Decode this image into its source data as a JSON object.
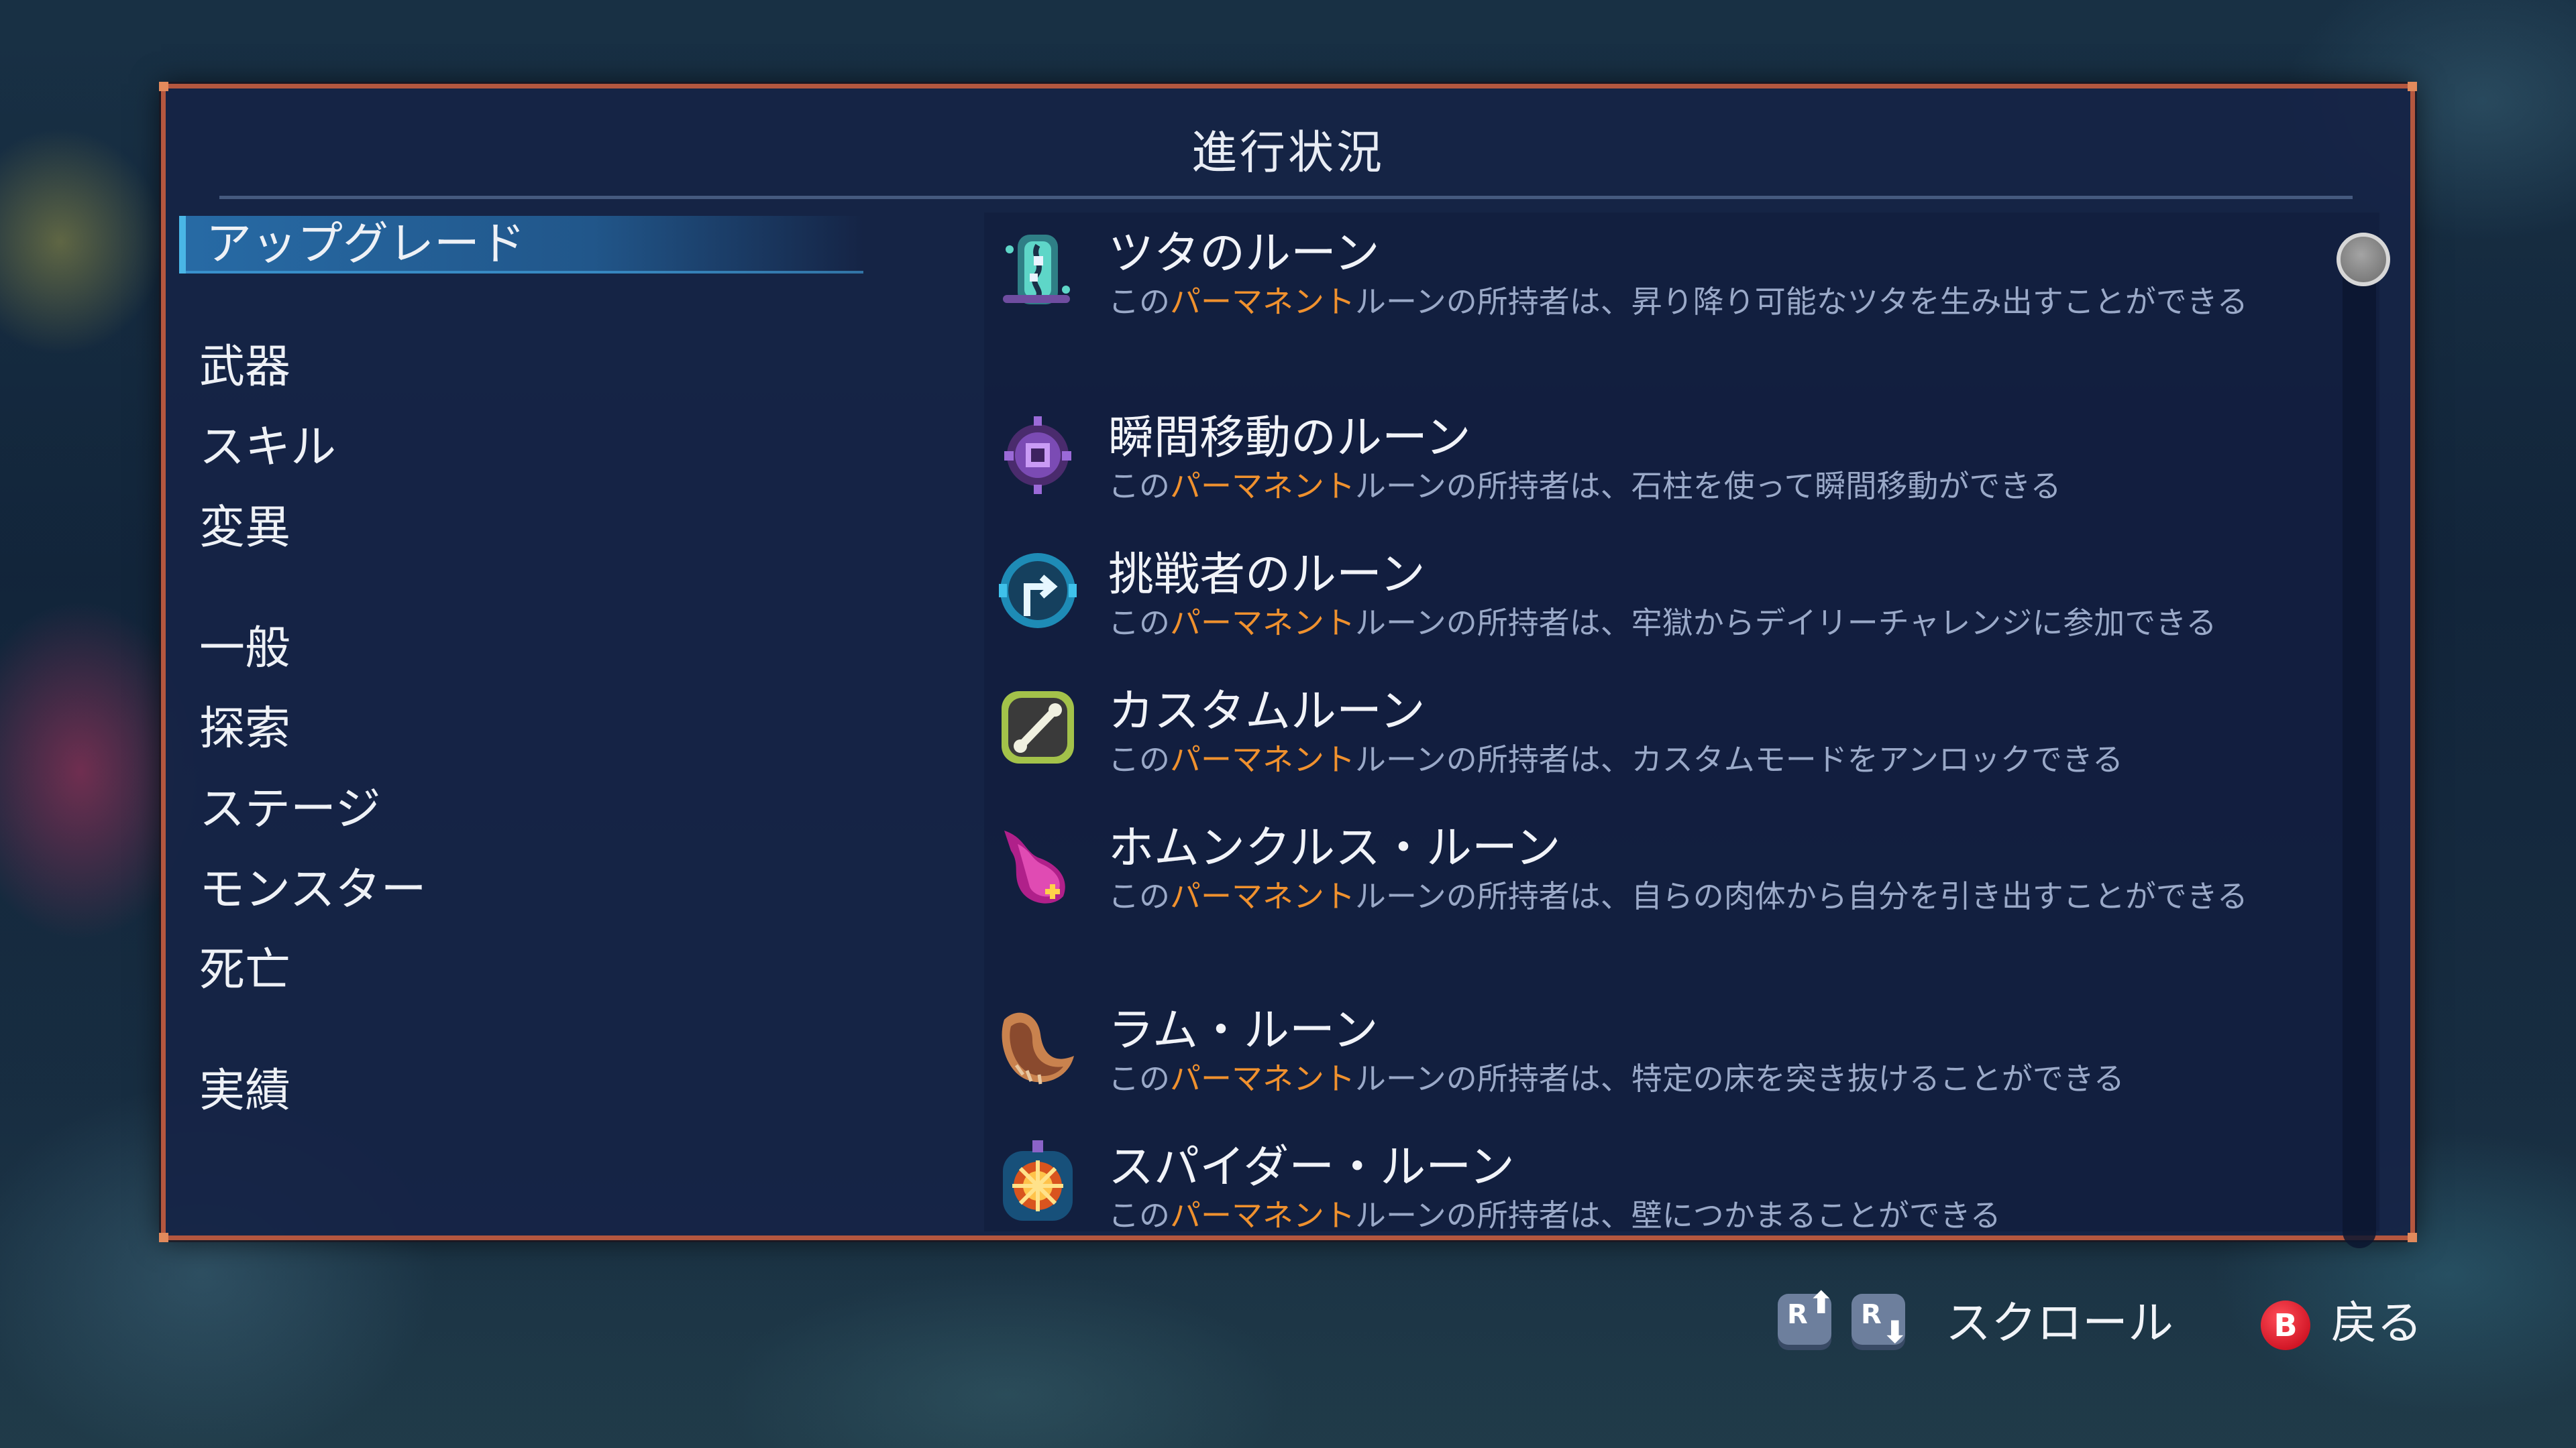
{
  "window": {
    "title": "進行状況"
  },
  "categories": [
    {
      "label": "アップグレード",
      "active": true
    },
    {
      "label": "武器",
      "active": false
    },
    {
      "label": "スキル",
      "active": false
    },
    {
      "label": "変異",
      "active": false
    },
    {
      "label": "一般",
      "active": false
    },
    {
      "label": "探索",
      "active": false
    },
    {
      "label": "ステージ",
      "active": false
    },
    {
      "label": "モンスター",
      "active": false
    },
    {
      "label": "死亡",
      "active": false
    },
    {
      "label": "実績",
      "active": false
    }
  ],
  "runes": [
    {
      "name": "ツタのルーン",
      "desc_prefix": "この",
      "desc_keyword": "パーマネント",
      "desc_suffix": "ルーンの所持者は、昇り降り可能なツタを生み出すことができる",
      "icon": "vine-rune-icon"
    },
    {
      "name": "瞬間移動のルーン",
      "desc_prefix": "この",
      "desc_keyword": "パーマネント",
      "desc_suffix": "ルーンの所持者は、石柱を使って瞬間移動ができる",
      "icon": "teleport-rune-icon"
    },
    {
      "name": "挑戦者のルーン",
      "desc_prefix": "この",
      "desc_keyword": "パーマネント",
      "desc_suffix": "ルーンの所持者は、牢獄からデイリーチャレンジに参加できる",
      "icon": "challenger-rune-icon"
    },
    {
      "name": "カスタムルーン",
      "desc_prefix": "この",
      "desc_keyword": "パーマネント",
      "desc_suffix": "ルーンの所持者は、カスタムモードをアンロックできる",
      "icon": "custom-rune-icon"
    },
    {
      "name": "ホムンクルス・ルーン",
      "desc_prefix": "この",
      "desc_keyword": "パーマネント",
      "desc_suffix": "ルーンの所持者は、自らの肉体から自分を引き出すことができる",
      "icon": "homunculus-rune-icon"
    },
    {
      "name": "ラム・ルーン",
      "desc_prefix": "この",
      "desc_keyword": "パーマネント",
      "desc_suffix": "ルーンの所持者は、特定の床を突き抜けることができる",
      "icon": "ram-rune-icon"
    },
    {
      "name": "スパイダー・ルーン",
      "desc_prefix": "この",
      "desc_keyword": "パーマネント",
      "desc_suffix": "ルーンの所持者は、壁につかまることができる",
      "icon": "spider-rune-icon"
    }
  ],
  "scrollbar": {
    "position": 0
  },
  "hints": {
    "scroll_up_button": "R",
    "scroll_down_button": "R",
    "scroll_label": "スクロール",
    "back_button": "B",
    "back_label": "戻る"
  },
  "colors": {
    "panel_border": "#b4573f",
    "keyword": "#f0912e",
    "selection": "#2a6fa8"
  }
}
